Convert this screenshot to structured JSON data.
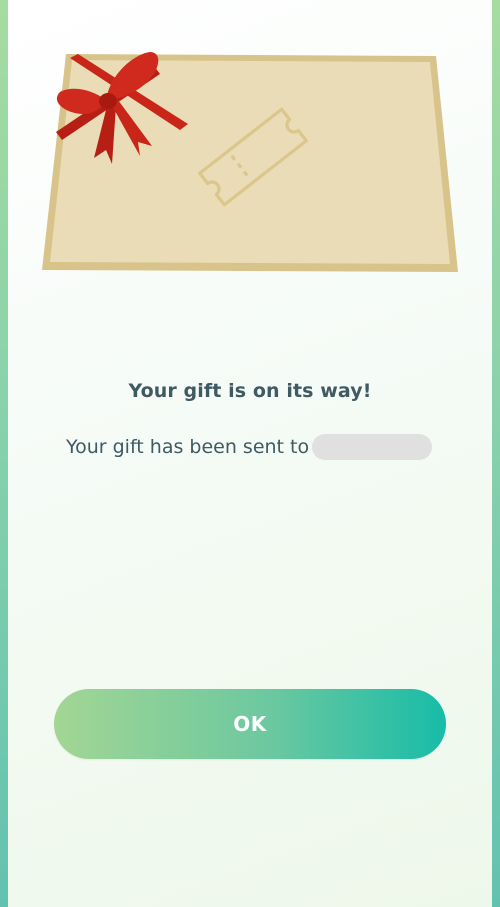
{
  "dialog": {
    "title": "Your gift is on its way!",
    "message": "Your gift has been sent to",
    "ok_label": "OK"
  },
  "colors": {
    "text": "#3f5a63",
    "card": "#e9dcb6",
    "card_border": "#d7c288",
    "ribbon": "#c9261a",
    "button_start": "#a2d694",
    "button_end": "#17bca8"
  },
  "icons": {
    "ticket": "ticket-icon",
    "ribbon": "bow-icon"
  }
}
